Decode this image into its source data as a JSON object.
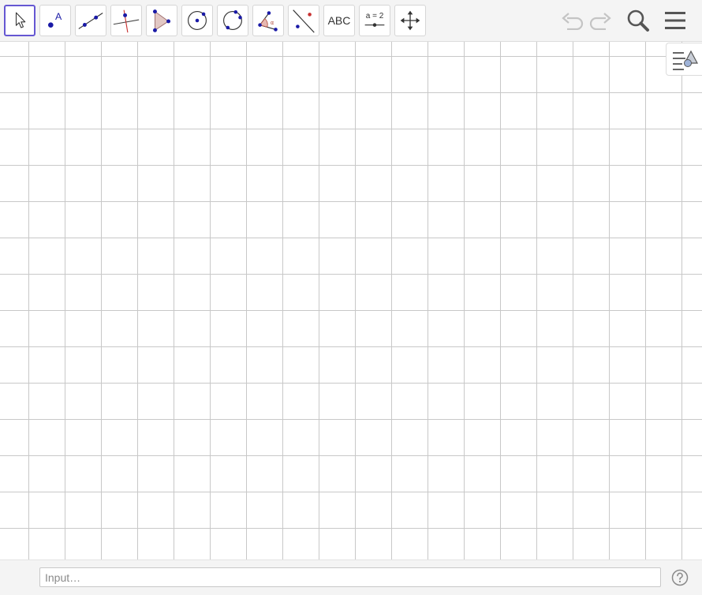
{
  "toolbar": {
    "tools": [
      {
        "name": "move-tool",
        "icon": "arrow-pointer-icon",
        "selected": true
      },
      {
        "name": "point-tool",
        "icon": "point-icon",
        "label": "A"
      },
      {
        "name": "line-tool",
        "icon": "line-through-points-icon"
      },
      {
        "name": "perpendicular-line-tool",
        "icon": "perpendicular-line-icon"
      },
      {
        "name": "polygon-tool",
        "icon": "polygon-icon"
      },
      {
        "name": "circle-tool",
        "icon": "circle-center-point-icon"
      },
      {
        "name": "circle-three-points-tool",
        "icon": "circle-three-points-icon"
      },
      {
        "name": "angle-tool",
        "icon": "angle-icon",
        "label": "α"
      },
      {
        "name": "reflect-tool",
        "icon": "reflect-about-line-icon"
      },
      {
        "name": "text-tool",
        "icon": "text-icon",
        "label": "ABC"
      },
      {
        "name": "slider-tool",
        "icon": "slider-icon",
        "label": "a = 2"
      },
      {
        "name": "move-graphics-view-tool",
        "icon": "move-arrows-icon"
      }
    ],
    "undo_icon": "undo-icon",
    "redo_icon": "redo-icon",
    "search_icon": "search-icon",
    "menu_icon": "hamburger-menu-icon"
  },
  "graphics_view": {
    "grid": true,
    "style_bar_icon": "style-bar-toggle-icon"
  },
  "input_bar": {
    "placeholder": "Input…",
    "help_icon": "help-icon"
  },
  "colors": {
    "accent": "#6557d2",
    "point": "#1a1aa6",
    "grid": "#c8c8c8",
    "toolbar_bg": "#f4f4f4"
  }
}
